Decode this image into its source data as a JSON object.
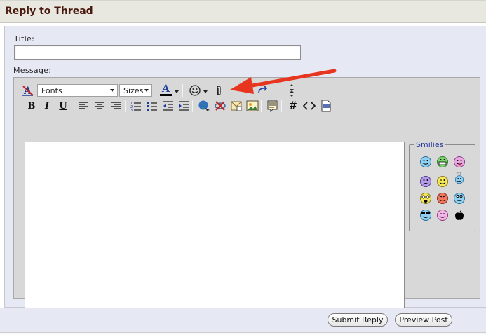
{
  "header": {
    "title": "Reply to Thread"
  },
  "form": {
    "title_label": "Title:",
    "title_value": "",
    "message_label": "Message:"
  },
  "toolbar": {
    "font_select": "Fonts",
    "size_select": "Sizes",
    "icons_row1": [
      "remove-format-icon",
      "font-color-icon",
      "smiley-picker-icon",
      "attachment-icon",
      "undo-icon",
      "redo-icon",
      "resize-toggle-icon"
    ],
    "icons_row2": [
      "bold-icon",
      "italic-icon",
      "underline-icon",
      "align-left-icon",
      "align-center-icon",
      "align-right-icon",
      "ordered-list-icon",
      "unordered-list-icon",
      "outdent-icon",
      "indent-icon",
      "insert-link-icon",
      "remove-link-icon",
      "insert-email-icon",
      "insert-image-icon",
      "quote-icon",
      "hash-icon",
      "code-icon",
      "php-icon"
    ],
    "font_color": "#000080"
  },
  "smilies": {
    "legend": "Smilies",
    "items": [
      "smile",
      "biggrin",
      "tongue",
      "frown",
      "wink",
      "confused",
      "eek",
      "mad",
      "cool",
      "rolleyes",
      "redface",
      "apple"
    ]
  },
  "annotation": {
    "arrow_color": "#e8351f"
  },
  "footer": {
    "submit_label": "Submit Reply",
    "preview_label": "Preview Post"
  }
}
